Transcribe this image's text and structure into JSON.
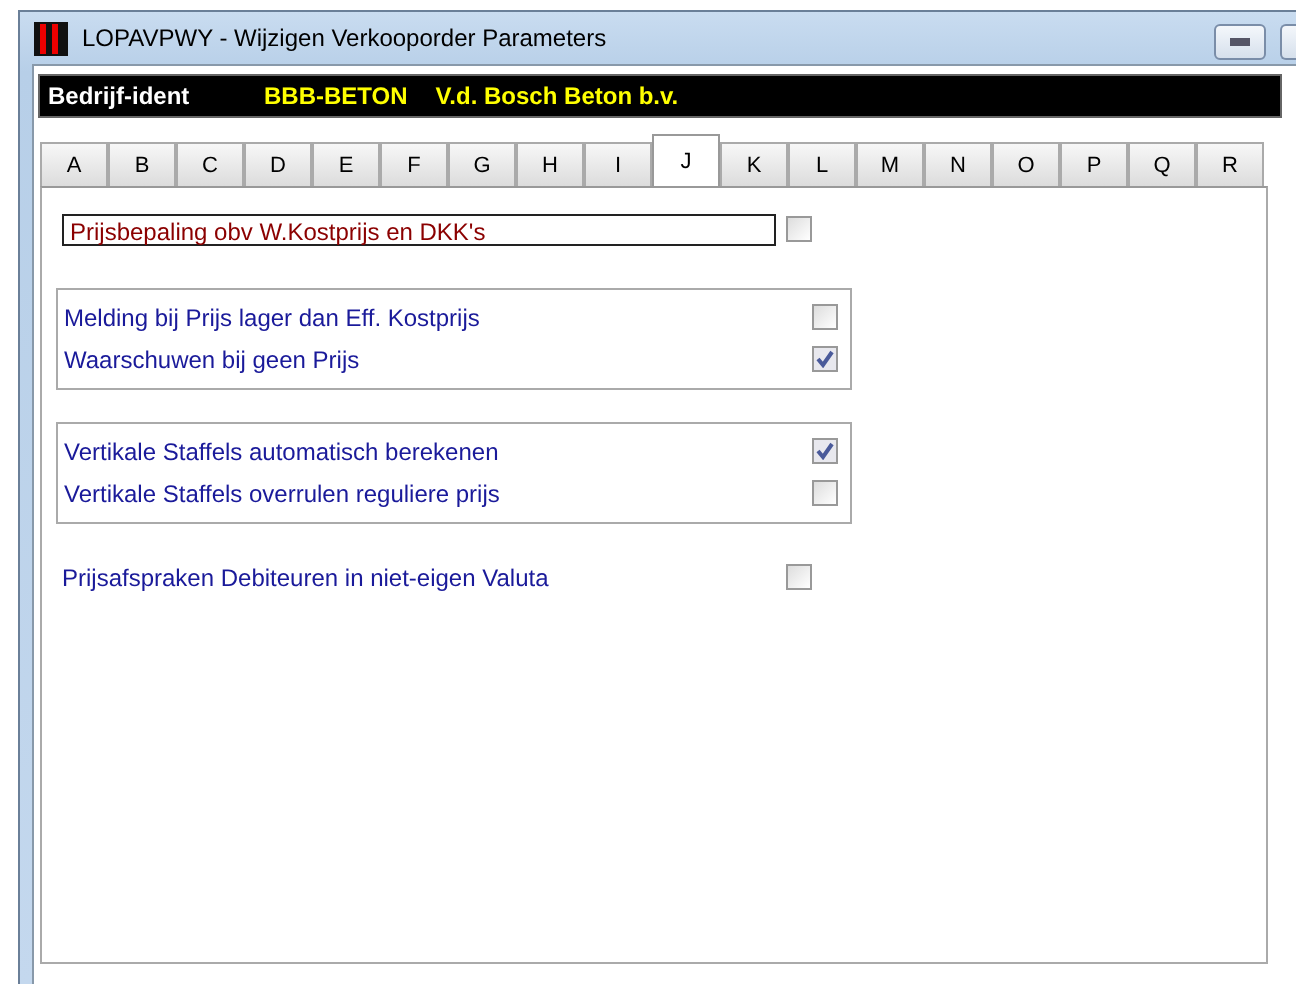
{
  "window": {
    "title": "LOPAVPWY - Wijzigen Verkooporder Parameters"
  },
  "company_bar": {
    "label": "Bedrijf-ident",
    "code": "BBB-BETON",
    "name": "V.d. Bosch Beton b.v."
  },
  "tabs": [
    {
      "label": "A",
      "selected": false
    },
    {
      "label": "B",
      "selected": false
    },
    {
      "label": "C",
      "selected": false
    },
    {
      "label": "D",
      "selected": false
    },
    {
      "label": "E",
      "selected": false
    },
    {
      "label": "F",
      "selected": false
    },
    {
      "label": "G",
      "selected": false
    },
    {
      "label": "H",
      "selected": false
    },
    {
      "label": "I",
      "selected": false
    },
    {
      "label": "J",
      "selected": true
    },
    {
      "label": "K",
      "selected": false
    },
    {
      "label": "L",
      "selected": false
    },
    {
      "label": "M",
      "selected": false
    },
    {
      "label": "N",
      "selected": false
    },
    {
      "label": "O",
      "selected": false
    },
    {
      "label": "P",
      "selected": false
    },
    {
      "label": "Q",
      "selected": false
    },
    {
      "label": "R",
      "selected": false
    }
  ],
  "sections": [
    {
      "kind": "highlighted",
      "items": [
        {
          "label": "Prijsbepaling obv W.Kostprijs en DKK's",
          "checked": false
        }
      ]
    },
    {
      "kind": "group",
      "items": [
        {
          "label": "Melding bij Prijs lager dan Eff. Kostprijs",
          "checked": false
        },
        {
          "label": "Waarschuwen bij geen Prijs",
          "checked": true
        }
      ]
    },
    {
      "kind": "group",
      "items": [
        {
          "label": "Vertikale Staffels automatisch berekenen",
          "checked": true
        },
        {
          "label": "Vertikale Staffels overrulen reguliere prijs",
          "checked": false
        }
      ]
    },
    {
      "kind": "plain",
      "items": [
        {
          "label": "Prijsafspraken Debiteuren in niet-eigen Valuta",
          "checked": false
        }
      ]
    }
  ]
}
